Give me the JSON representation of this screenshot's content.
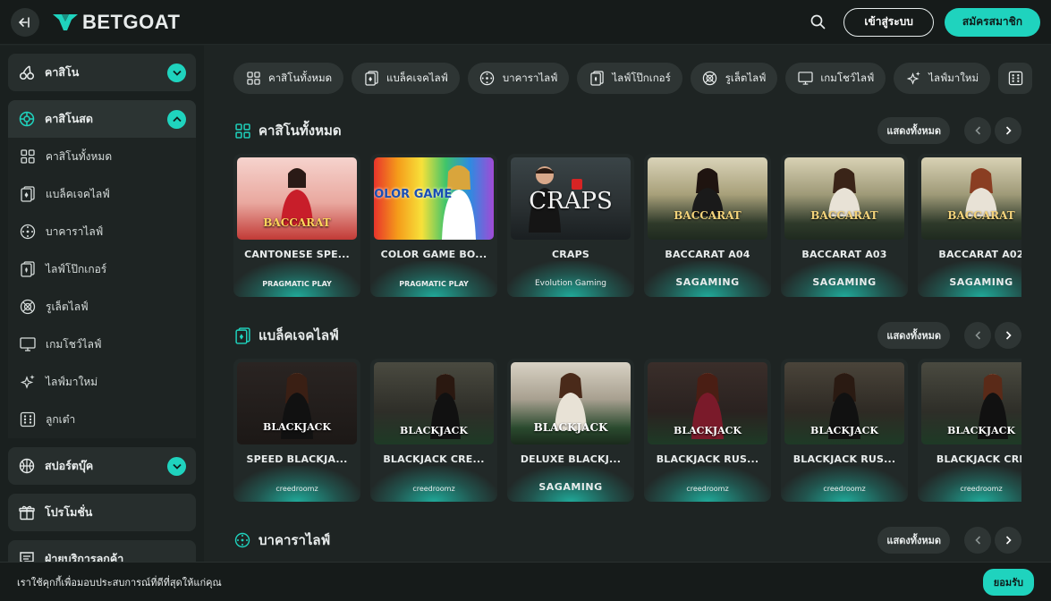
{
  "header": {
    "brand": "BETGOAT",
    "login_label": "เข้าสู่ระบบ",
    "register_label": "สมัครสมาชิก"
  },
  "sidebar": {
    "casino": "คาสิโน",
    "live_casino": "คาสิโนสด",
    "live_items": [
      "คาสิโนทั้งหมด",
      "แบล็คเจคไลฟ์",
      "บาคาราไลฟ์",
      "ไลฟ์โป๊กเกอร์",
      "รูเล็ตไลฟ์",
      "เกมโชว์ไลฟ์",
      "ไลฟ์มาใหม่",
      "ลูกเต๋า"
    ],
    "sportsbook": "สปอร์ตบุ๊ค",
    "promotions": "โปรโมชั่น",
    "support": "ฝ่ายบริการลูกค้า"
  },
  "filters": [
    "คาสิโนทั้งหมด",
    "แบล็คเจคไลฟ์",
    "บาคาราไลฟ์",
    "ไลฟ์โป๊กเกอร์",
    "รูเล็ตไลฟ์",
    "เกมโชว์ไลฟ์",
    "ไลฟ์มาใหม่"
  ],
  "sections": [
    {
      "title": "คาสิโนทั้งหมด",
      "show_all": "แสดงทั้งหมด",
      "games": [
        {
          "name": "CANTONESE SPE...",
          "provider": "PRAGMATIC PLAY",
          "art": "BACCARAT"
        },
        {
          "name": "COLOR GAME BO...",
          "provider": "PRAGMATIC PLAY",
          "art": "COLOR GAME"
        },
        {
          "name": "CRAPS",
          "provider": "Evolution Gaming",
          "art": "CRAPS"
        },
        {
          "name": "BACCARAT A04",
          "provider": "SAGAMING",
          "art": "BACCARAT"
        },
        {
          "name": "BACCARAT A03",
          "provider": "SAGAMING",
          "art": "BACCARAT"
        },
        {
          "name": "BACCARAT A02",
          "provider": "SAGAMING",
          "art": "BACCARAT"
        }
      ]
    },
    {
      "title": "แบล็คเจคไลฟ์",
      "show_all": "แสดงทั้งหมด",
      "games": [
        {
          "name": "SPEED BLACKJA...",
          "provider": "creedroomz",
          "art": "BLACKJACK"
        },
        {
          "name": "BLACKJACK CRE...",
          "provider": "creedroomz",
          "art": "BLACKJACK"
        },
        {
          "name": "DELUXE BLACKJ...",
          "provider": "SAGAMING",
          "art": "BLACKJACK"
        },
        {
          "name": "BLACKJACK RUS...",
          "provider": "creedroomz",
          "art": "BLACKJACK"
        },
        {
          "name": "BLACKJACK RUS...",
          "provider": "creedroomz",
          "art": "BLACKJACK"
        },
        {
          "name": "BLACKJACK CRE",
          "provider": "creedroomz",
          "art": "BLACKJACK"
        }
      ]
    },
    {
      "title": "บาคาราไลฟ์",
      "show_all": "แสดงทั้งหมด",
      "games": []
    }
  ],
  "cookie": {
    "text": "เราใช้คุกกี้เพื่อมอบประสบการณ์ที่ดีที่สุดให้แก่คุณ",
    "accept": "ยอมรับ"
  },
  "colors": {
    "accent": "#1fd3be",
    "bg": "#1e2423",
    "card": "#222928"
  }
}
